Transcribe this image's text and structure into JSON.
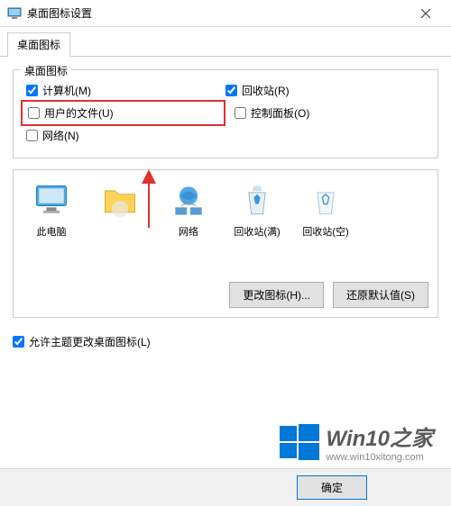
{
  "titlebar": {
    "title": "桌面图标设置"
  },
  "tab": {
    "label": "桌面图标"
  },
  "group": {
    "title": "桌面图标",
    "computer": "计算机(M)",
    "recycle": "回收站(R)",
    "userfiles": "用户的文件(U)",
    "control": "控制面板(O)",
    "network": "网络(N)"
  },
  "preview": {
    "items": [
      {
        "label": "此电脑"
      },
      {
        "label": ""
      },
      {
        "label": "网络"
      },
      {
        "label": "回收站(满)"
      },
      {
        "label": "回收站(空)"
      }
    ]
  },
  "buttons": {
    "change_icon": "更改图标(H)...",
    "restore_default": "还原默认值(S)"
  },
  "allow_theme": "允许主题更改桌面图标(L)",
  "footer": {
    "ok": "确定"
  },
  "watermark": {
    "main": "Win10之家",
    "sub": "www.win10xitong.com"
  }
}
